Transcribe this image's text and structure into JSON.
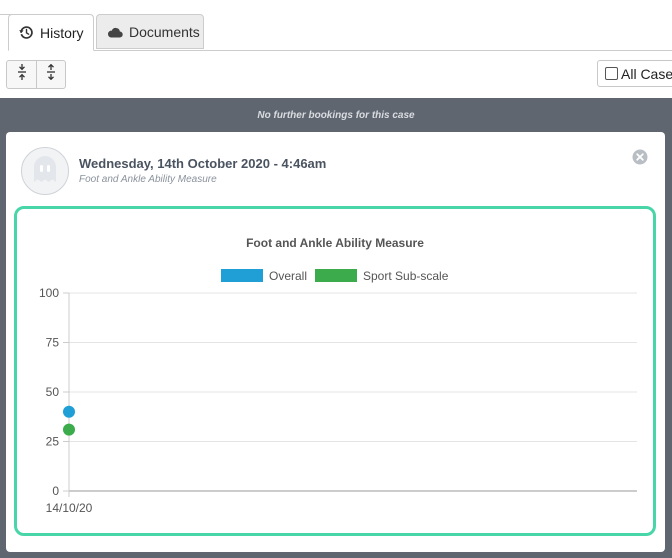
{
  "tabs": {
    "history_label": "History",
    "documents_label": "Documents"
  },
  "toolbar": {
    "all_cases_label": "All Cases",
    "collapse_icon": "collapse-vertical-icon",
    "expand_icon": "expand-vertical-icon"
  },
  "timeline": {
    "no_bookings_text": "No further bookings for this case"
  },
  "entry": {
    "datetime": "Wednesday, 14th October 2020 - 4:46am",
    "measure_name": "Foot and Ankle Ability Measure"
  },
  "colors": {
    "accent_border": "#48d6a8",
    "overall": "#1f9fd5",
    "sport": "#3bab4b"
  },
  "chart_data": {
    "type": "scatter",
    "title": "Foot and Ankle Ability Measure",
    "xlabel": "",
    "ylabel": "",
    "categories": [
      "14/10/20"
    ],
    "yticks": [
      0,
      25,
      50,
      75,
      100
    ],
    "ylim": [
      0,
      100
    ],
    "grid": true,
    "legend_position": "top",
    "series": [
      {
        "name": "Overall",
        "color": "#1f9fd5",
        "values": [
          40
        ]
      },
      {
        "name": "Sport Sub-scale",
        "color": "#3bab4b",
        "values": [
          31
        ]
      }
    ]
  }
}
